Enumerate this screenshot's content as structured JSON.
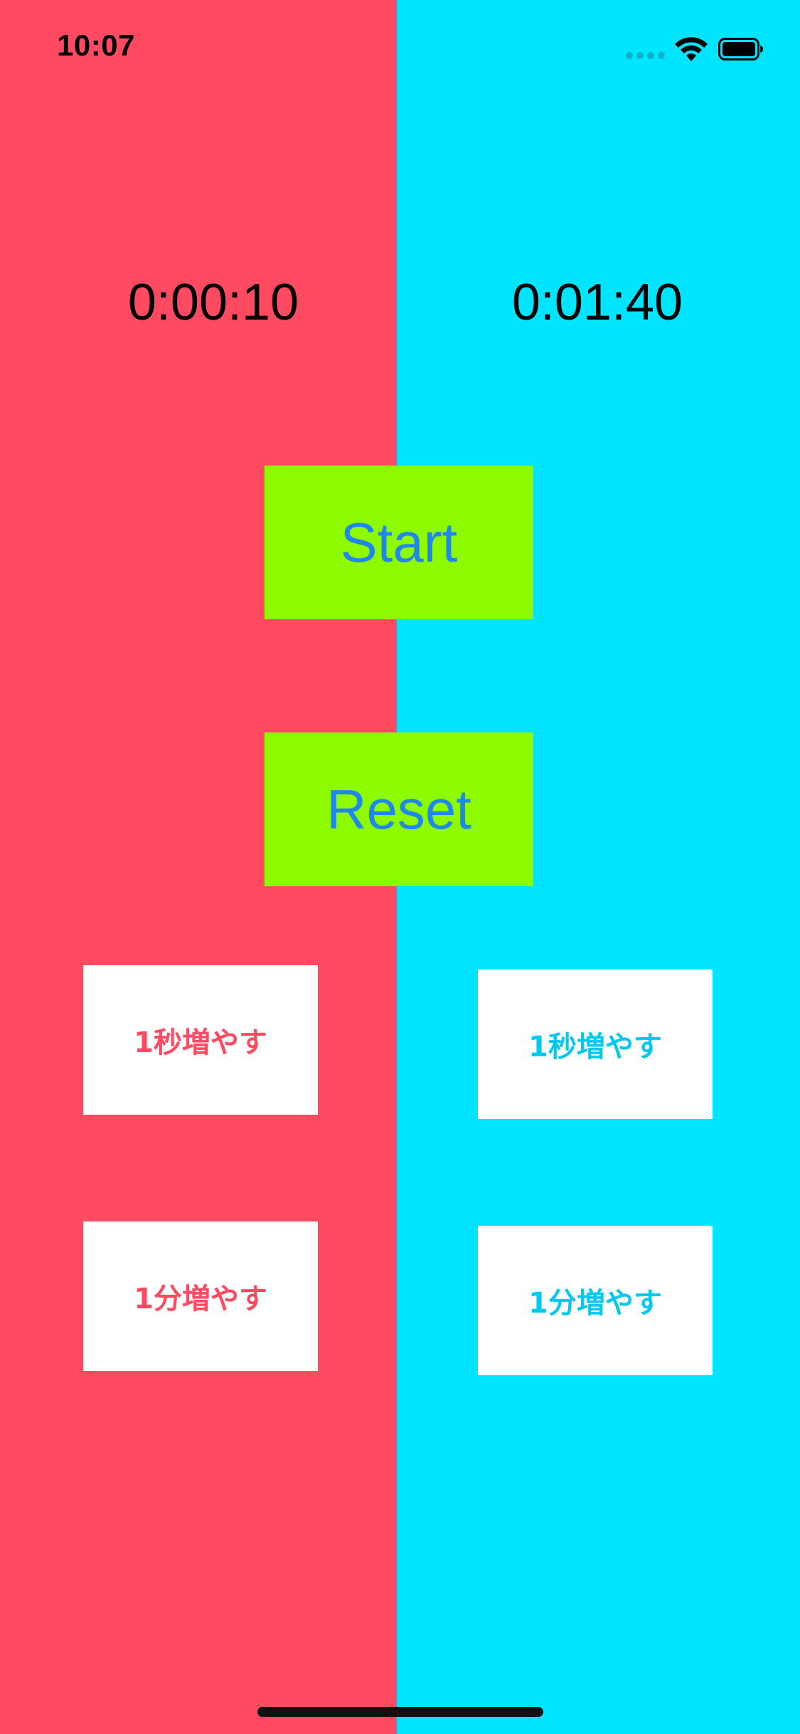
{
  "colors": {
    "left_panel": "#ff4a62",
    "right_panel": "#00e4ff",
    "main_button_bg": "#8efa00",
    "main_button_text": "#1e88f0",
    "left_button_text": "#ff4a62",
    "right_button_text": "#00c8ef"
  },
  "status_bar": {
    "time": "10:07",
    "icons": [
      "cellular-signal-icon",
      "wifi-icon",
      "battery-icon"
    ]
  },
  "timers": {
    "left": "0:00:10",
    "right": "0:01:40"
  },
  "controls": {
    "start_label": "Start",
    "reset_label": "Reset"
  },
  "left_player": {
    "add_second_label": "1秒増やす",
    "add_minute_label": "1分増やす"
  },
  "right_player": {
    "add_second_label": "1秒増やす",
    "add_minute_label": "1分増やす"
  }
}
